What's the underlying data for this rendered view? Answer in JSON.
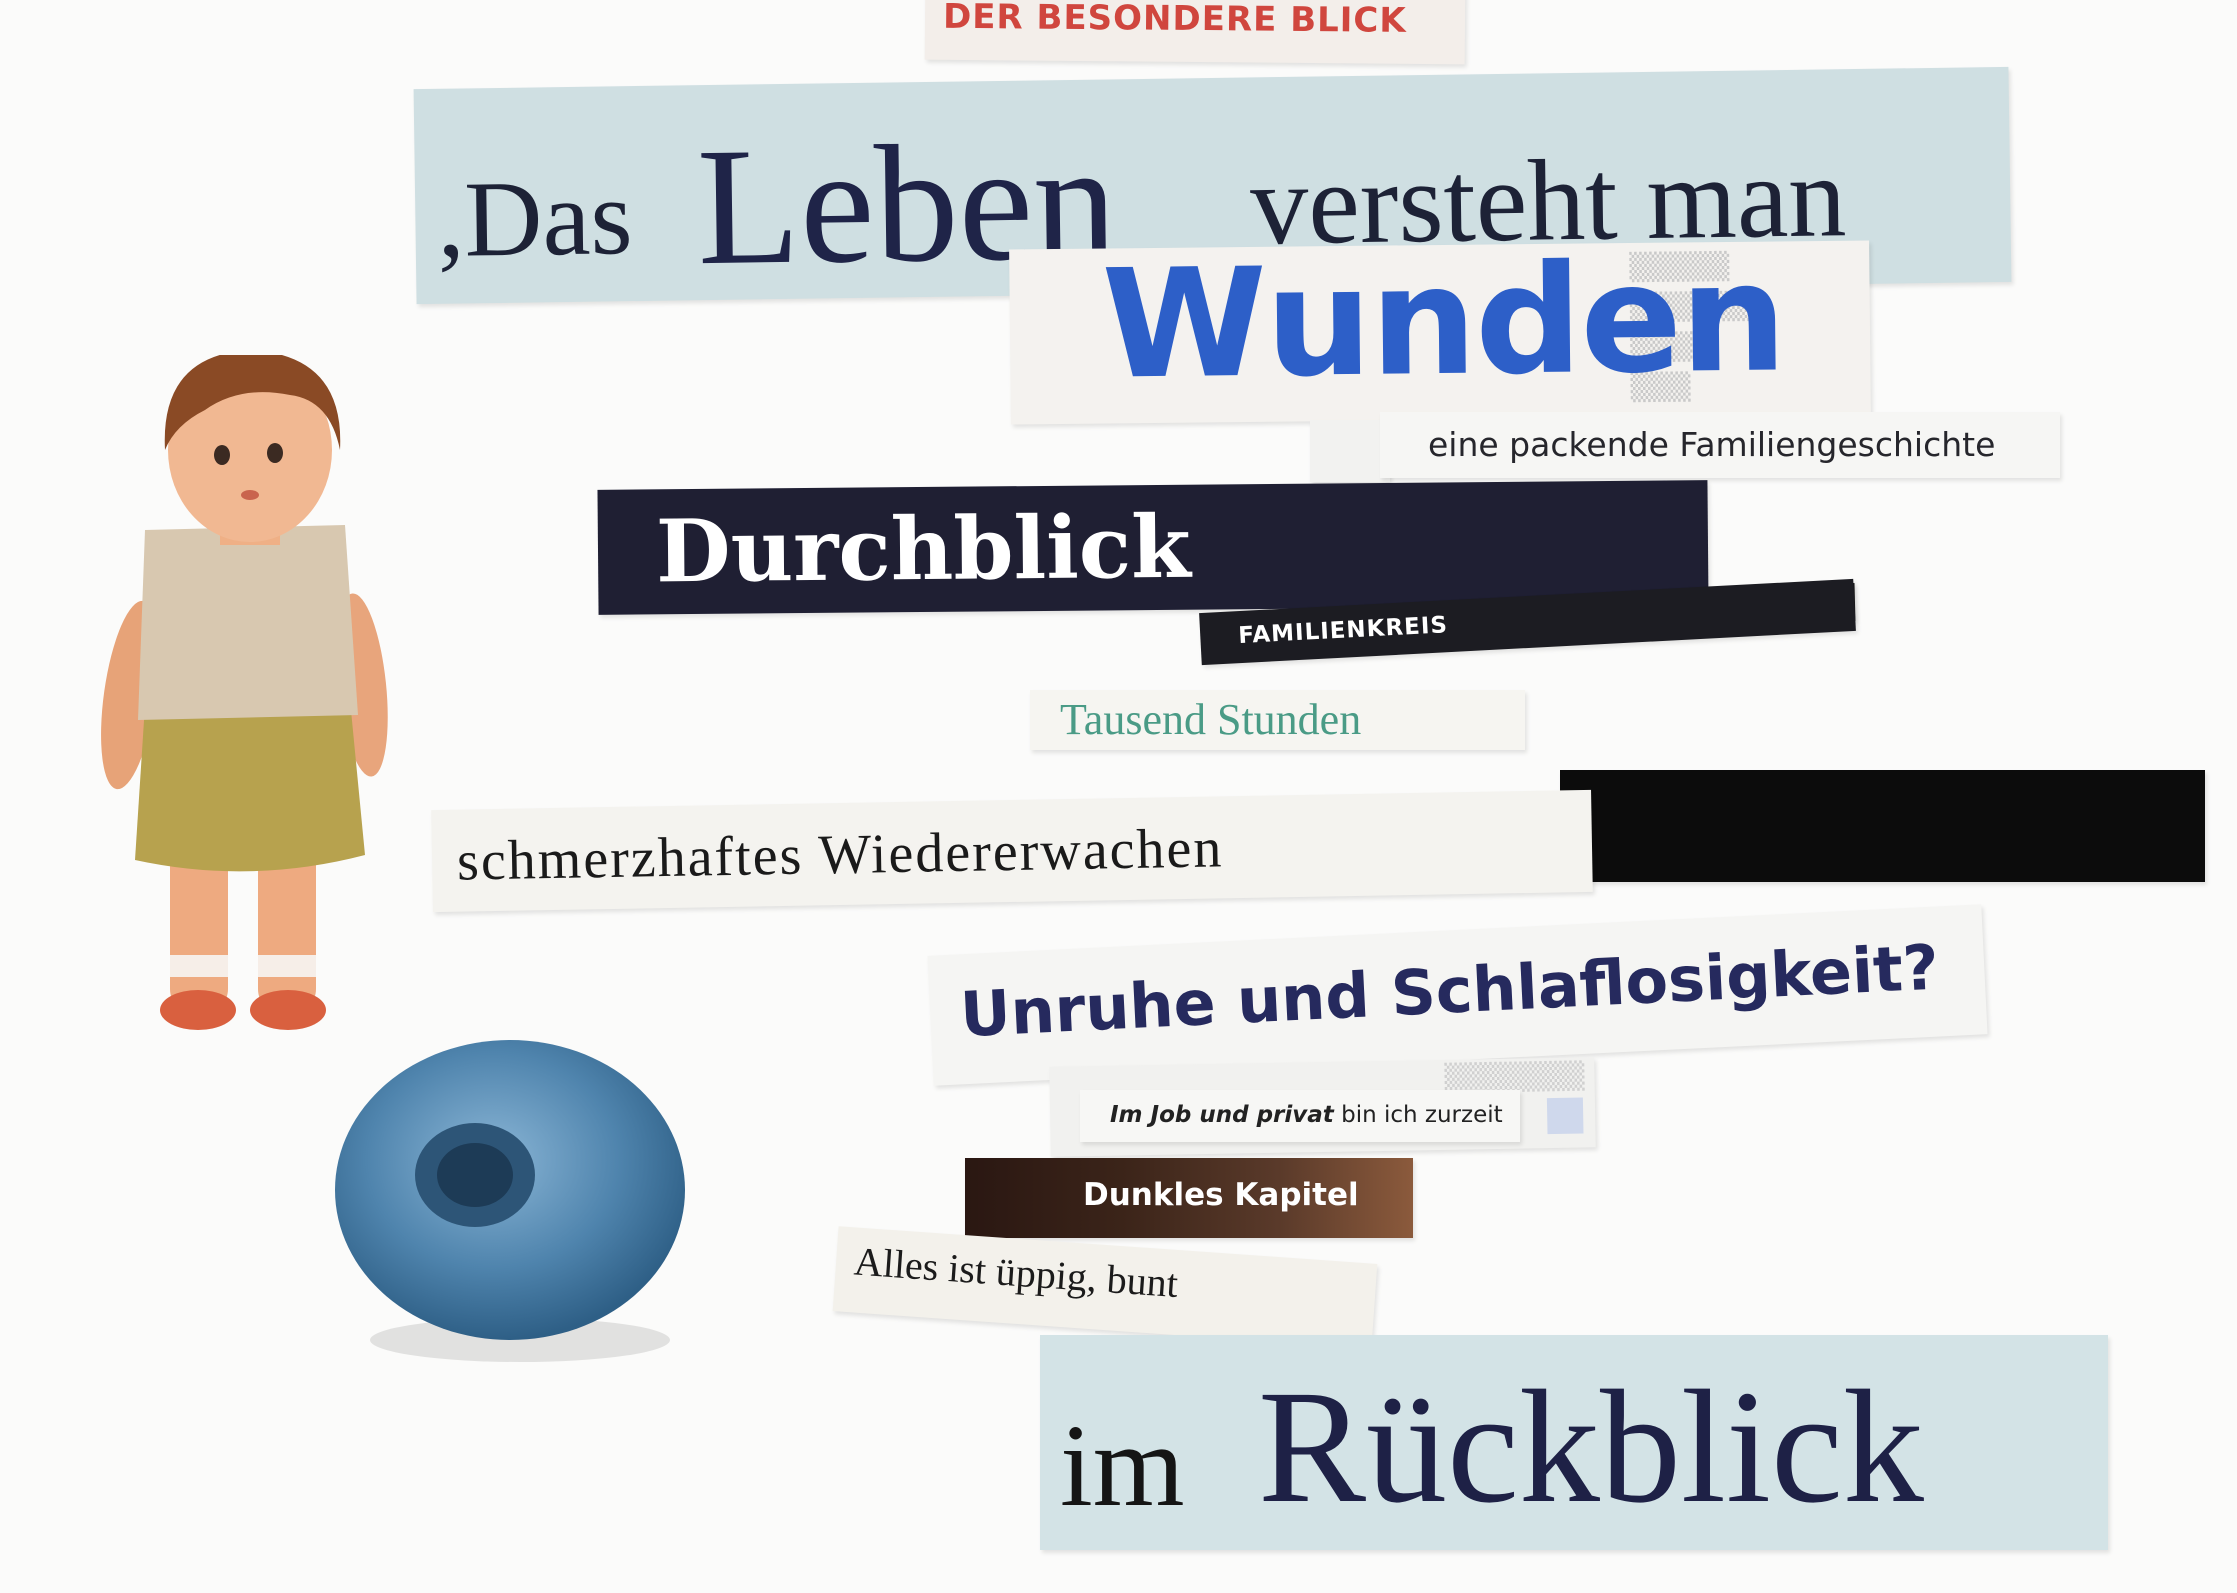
{
  "clippings": {
    "top": "DER BESONDERE BLICK",
    "leben_pre": ",Das",
    "leben_big": "Leben",
    "leben_post": "versteht man",
    "wunden": "Wunden",
    "packende": "eine packende Familiengeschichte",
    "durchblick": "Durchblick",
    "familienkreis": "FAMILIENKREIS",
    "tausend": "Tausend Stunden",
    "schmerz": "schmerzhaftes Wiedererwachen",
    "unruhe": "Unruhe und Schlaflosigkeit?",
    "job_bold": "Im Job und privat",
    "job_rest": " bin ich zurzeit",
    "dunkles": "Dunkles Kapitel",
    "alles": "Alles ist üppig, bunt",
    "rueck_pre": "im",
    "rueck_big": "Rückblick"
  },
  "objects": {
    "doll": "doll",
    "ring": "blue wooden ring"
  }
}
